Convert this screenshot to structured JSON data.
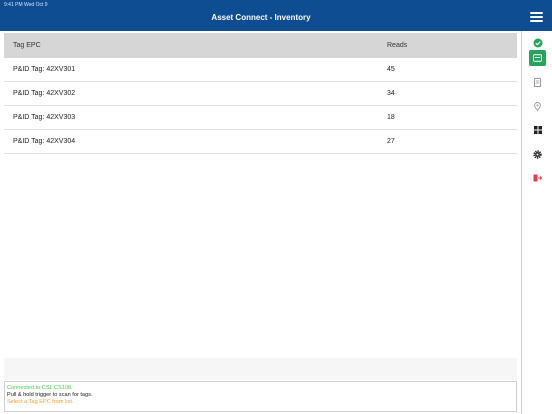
{
  "header": {
    "status_text": "9:41 PM  Wed Oct 9",
    "title": "Asset Connect - Inventory",
    "menu_icon": "hamburger-menu-icon"
  },
  "table": {
    "columns": [
      "Tag EPC",
      "Reads"
    ],
    "rows": [
      {
        "tag": "P&ID Tag: 42XV301",
        "reads": "45"
      },
      {
        "tag": "P&ID Tag: 42XV302",
        "reads": "34"
      },
      {
        "tag": "P&ID Tag: 42XV303",
        "reads": "18"
      },
      {
        "tag": "P&ID Tag: 42XV304",
        "reads": "27"
      }
    ]
  },
  "sidebar": {
    "items": [
      {
        "icon": "check-circle-icon",
        "color": "#27a35a",
        "active": false
      },
      {
        "icon": "inventory-icon",
        "color": "#ffffff",
        "active": true
      },
      {
        "icon": "document-icon",
        "color": "#9a9a9a",
        "active": false
      },
      {
        "icon": "location-pin-icon",
        "color": "#9a9a9a",
        "active": false
      },
      {
        "icon": "grid-icon",
        "color": "#222222",
        "active": false
      },
      {
        "icon": "gear-icon",
        "color": "#222222",
        "active": false
      },
      {
        "icon": "logout-icon",
        "color": "#e0404a",
        "active": false
      }
    ]
  },
  "status_panel": {
    "connected": "Connected to CSL CS108.",
    "instruction": "Pull & hold trigger to scan for tags.",
    "hint": "Select a Tag EPC from list."
  },
  "colors": {
    "header_bg": "#0e4d92",
    "accent_green": "#27a35a",
    "status_green": "#4cc94c",
    "status_orange": "#f0a030",
    "logout_red": "#e0404a"
  }
}
